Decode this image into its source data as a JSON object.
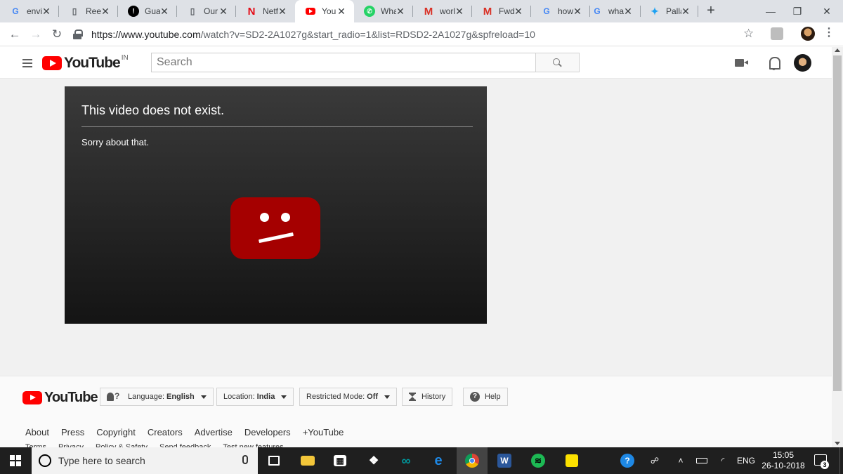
{
  "browser": {
    "tabs": [
      {
        "favicon": "G",
        "favicon_color": "#4285f4",
        "title": "envi"
      },
      {
        "favicon": "doc",
        "favicon_color": "#5f6368",
        "title": "Reer"
      },
      {
        "favicon": "!",
        "favicon_color": "#000000",
        "title": "Guar"
      },
      {
        "favicon": "doc",
        "favicon_color": "#5f6368",
        "title": "Our"
      },
      {
        "favicon": "N",
        "favicon_color": "#e50914",
        "title": "Netf"
      },
      {
        "favicon": "yt",
        "favicon_color": "#ff0000",
        "title": "You"
      },
      {
        "favicon": "wa",
        "favicon_color": "#25d366",
        "title": "Wha"
      },
      {
        "favicon": "M",
        "favicon_color": "#d93025",
        "title": "worl"
      },
      {
        "favicon": "M",
        "favicon_color": "#d93025",
        "title": "Fwd"
      },
      {
        "favicon": "G",
        "favicon_color": "#4285f4",
        "title": "how"
      },
      {
        "favicon": "G",
        "favicon_color": "#4285f4",
        "title": "wha"
      },
      {
        "favicon": "tw",
        "favicon_color": "#1da1f2",
        "title": "Palla"
      }
    ],
    "active_tab_index": 5,
    "new_tab": "+",
    "url_host": "https://www.youtube.com",
    "url_path": "/watch?v=SD2-2A1027g&start_radio=1&list=RDSD2-2A1027g&spfreload=10"
  },
  "youtube": {
    "logo_text": "YouTube",
    "region": "IN",
    "search_placeholder": "Search",
    "error_title": "This video does not exist.",
    "error_subtitle": "Sorry about that.",
    "brand_red": "#ff0000",
    "sad_icon_color": "#a50000"
  },
  "footer": {
    "logo_text": "YouTube",
    "language_label": "Language:",
    "language_value": "English",
    "location_label": "Location:",
    "location_value": "India",
    "restricted_label": "Restricted Mode:",
    "restricted_value": "Off",
    "history": "History",
    "help": "Help",
    "links": [
      "About",
      "Press",
      "Copyright",
      "Creators",
      "Advertise",
      "Developers",
      "+YouTube"
    ],
    "links2": [
      "Terms",
      "Privacy",
      "Policy & Safety",
      "Send feedback",
      "Test new features"
    ]
  },
  "taskbar": {
    "search_placeholder": "Type here to search",
    "language": "ENG",
    "time": "15:05",
    "date": "26-10-2018",
    "notification_count": "3"
  }
}
